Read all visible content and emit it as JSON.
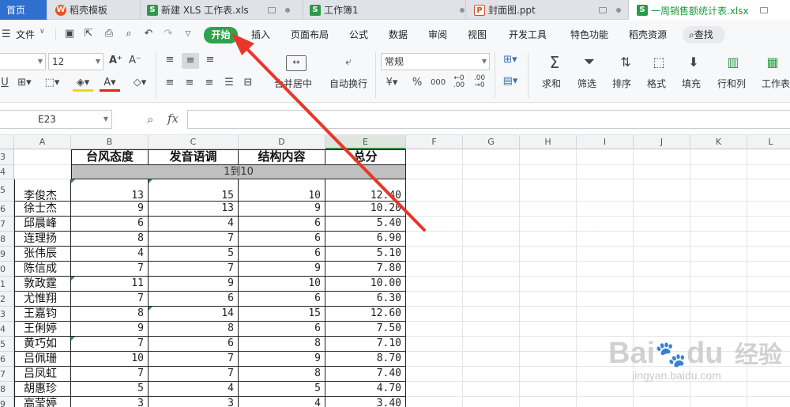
{
  "tabs": [
    {
      "label": "首页",
      "active": false
    },
    {
      "label": "稻壳模板",
      "icon": "wps-logo-icon"
    },
    {
      "label": "新建 XLS 工作表.xls",
      "icon": "spreadsheet-icon"
    },
    {
      "label": "工作簿1",
      "icon": "spreadsheet-icon"
    },
    {
      "label": "封面图.ppt",
      "icon": "presentation-icon"
    },
    {
      "label": "一周销售额统计表.xlsx",
      "icon": "spreadsheet-icon",
      "active": true
    }
  ],
  "menu": {
    "file": "文件",
    "items": [
      "开始",
      "插入",
      "页面布局",
      "公式",
      "数据",
      "审阅",
      "视图",
      "开发工具",
      "特色功能",
      "稻壳资源"
    ],
    "search": "查找"
  },
  "ribbon": {
    "font_size": "12",
    "number_format": "常规",
    "merge_center": "合并居中",
    "wrap_text": "自动换行",
    "sum": "求和",
    "filter": "筛选",
    "sort": "排序",
    "format": "格式",
    "fill": "填充",
    "row_col": "行和列",
    "worksheet": "工作表"
  },
  "formula_bar": {
    "name_box": "E23",
    "fx": "fx",
    "value": ""
  },
  "sheet": {
    "columns": [
      "A",
      "B",
      "C",
      "D",
      "E",
      "F",
      "G",
      "H",
      "I",
      "J",
      "K",
      "L"
    ],
    "selected_column": "E",
    "headers": [
      "台风态度",
      "发音语调",
      "结构内容",
      "总分"
    ],
    "range_label": "1到10",
    "rows": [
      {
        "row": "5",
        "name": "李俊杰",
        "b": "13",
        "c": "15",
        "d": "10",
        "e": "12.40"
      },
      {
        "row": "6",
        "name": "徐士杰",
        "b": "9",
        "c": "13",
        "d": "9",
        "e": "10.20"
      },
      {
        "row": "7",
        "name": "邱晨峰",
        "b": "6",
        "c": "4",
        "d": "6",
        "e": "5.40"
      },
      {
        "row": "8",
        "name": "连理扬",
        "b": "8",
        "c": "7",
        "d": "6",
        "e": "6.90"
      },
      {
        "row": "9",
        "name": "张伟辰",
        "b": "4",
        "c": "5",
        "d": "6",
        "e": "5.10"
      },
      {
        "row": "10",
        "name": "陈信成",
        "b": "7",
        "c": "7",
        "d": "9",
        "e": "7.80"
      },
      {
        "row": "11",
        "name": "敦政霆",
        "b": "11",
        "c": "9",
        "d": "10",
        "e": "10.00"
      },
      {
        "row": "12",
        "name": "尤惟翔",
        "b": "7",
        "c": "6",
        "d": "6",
        "e": "6.30"
      },
      {
        "row": "13",
        "name": "王嘉钧",
        "b": "8",
        "c": "14",
        "d": "15",
        "e": "12.60"
      },
      {
        "row": "14",
        "name": "王俐婷",
        "b": "9",
        "c": "8",
        "d": "6",
        "e": "7.50"
      },
      {
        "row": "15",
        "name": "黄巧如",
        "b": "7",
        "c": "6",
        "d": "8",
        "e": "7.10"
      },
      {
        "row": "16",
        "name": "吕佩珊",
        "b": "10",
        "c": "7",
        "d": "9",
        "e": "8.70"
      },
      {
        "row": "17",
        "name": "吕凤虹",
        "b": "7",
        "c": "7",
        "d": "8",
        "e": "7.40"
      },
      {
        "row": "18",
        "name": "胡惠珍",
        "b": "5",
        "c": "4",
        "d": "5",
        "e": "4.70"
      },
      {
        "row": "19",
        "name": "高莹婷",
        "b": "3",
        "c": "3",
        "d": "4",
        "e": "3.40"
      }
    ]
  },
  "watermark": {
    "brand": "Bai",
    "brand2": "du",
    "cn": "经验",
    "url": "jingyan.baidu.com"
  },
  "colors": {
    "accent": "#2ea24c",
    "annotation": "#e8362a"
  }
}
